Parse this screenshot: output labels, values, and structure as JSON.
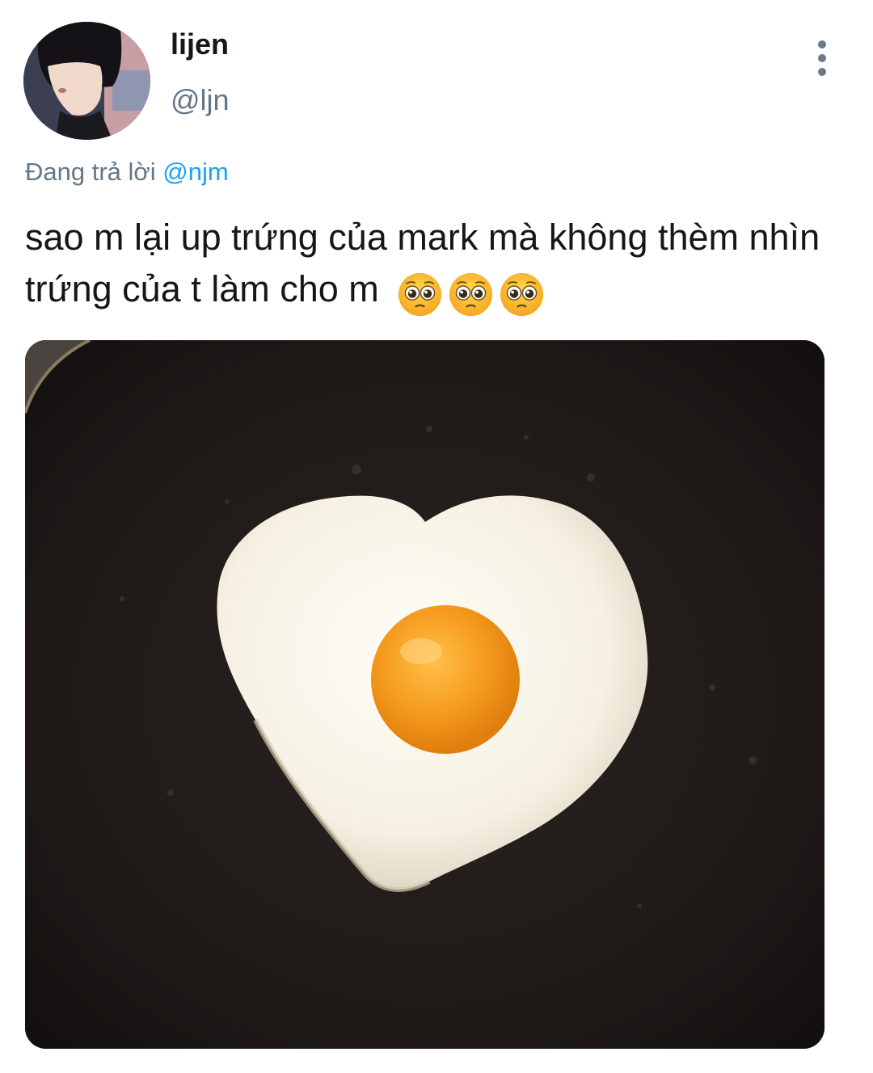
{
  "tweet": {
    "display_name": "lijen",
    "handle": "@ljn",
    "replying_to_prefix": "Đang trả lời",
    "replying_to_mention": "@njm",
    "text": "sao m lại up trứng của mark mà không thèm nhìn trứng của t làm cho m",
    "emojis": [
      "pleading-face-emoji",
      "pleading-face-emoji",
      "pleading-face-emoji"
    ],
    "more_icon": "more-vertical-icon"
  },
  "colors": {
    "name": "#14171a",
    "handle": "#657786",
    "mention": "#1da1f2"
  }
}
